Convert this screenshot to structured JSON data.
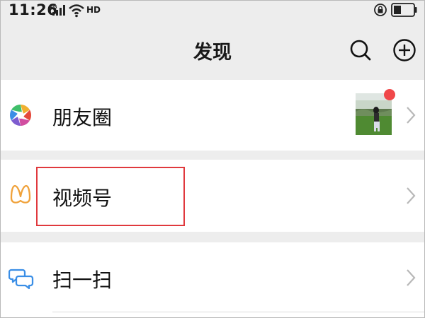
{
  "status_bar": {
    "time": "11:26",
    "network": "4G",
    "hd_label": "HD",
    "icons": [
      "signal-icon",
      "wifi-icon",
      "lock-rotation-icon",
      "battery-icon"
    ]
  },
  "header": {
    "title": "发现",
    "actions": [
      "search-icon",
      "add-circle-icon"
    ]
  },
  "list": {
    "items": [
      {
        "label": "朋友圈",
        "icon": "aperture-icon",
        "has_thumbnail": true,
        "has_badge": true
      },
      {
        "label": "视频号",
        "icon": "butterfly-channels-icon",
        "highlighted": true
      },
      {
        "label": "扫一扫",
        "icon": "scan-chat-icon"
      }
    ]
  },
  "colors": {
    "background": "#ededed",
    "row_background": "#ffffff",
    "badge_red": "#f0484a",
    "highlight_red": "#e0393d",
    "channels_icon": "#f0a23b",
    "scan_icon": "#3a8ee6"
  }
}
